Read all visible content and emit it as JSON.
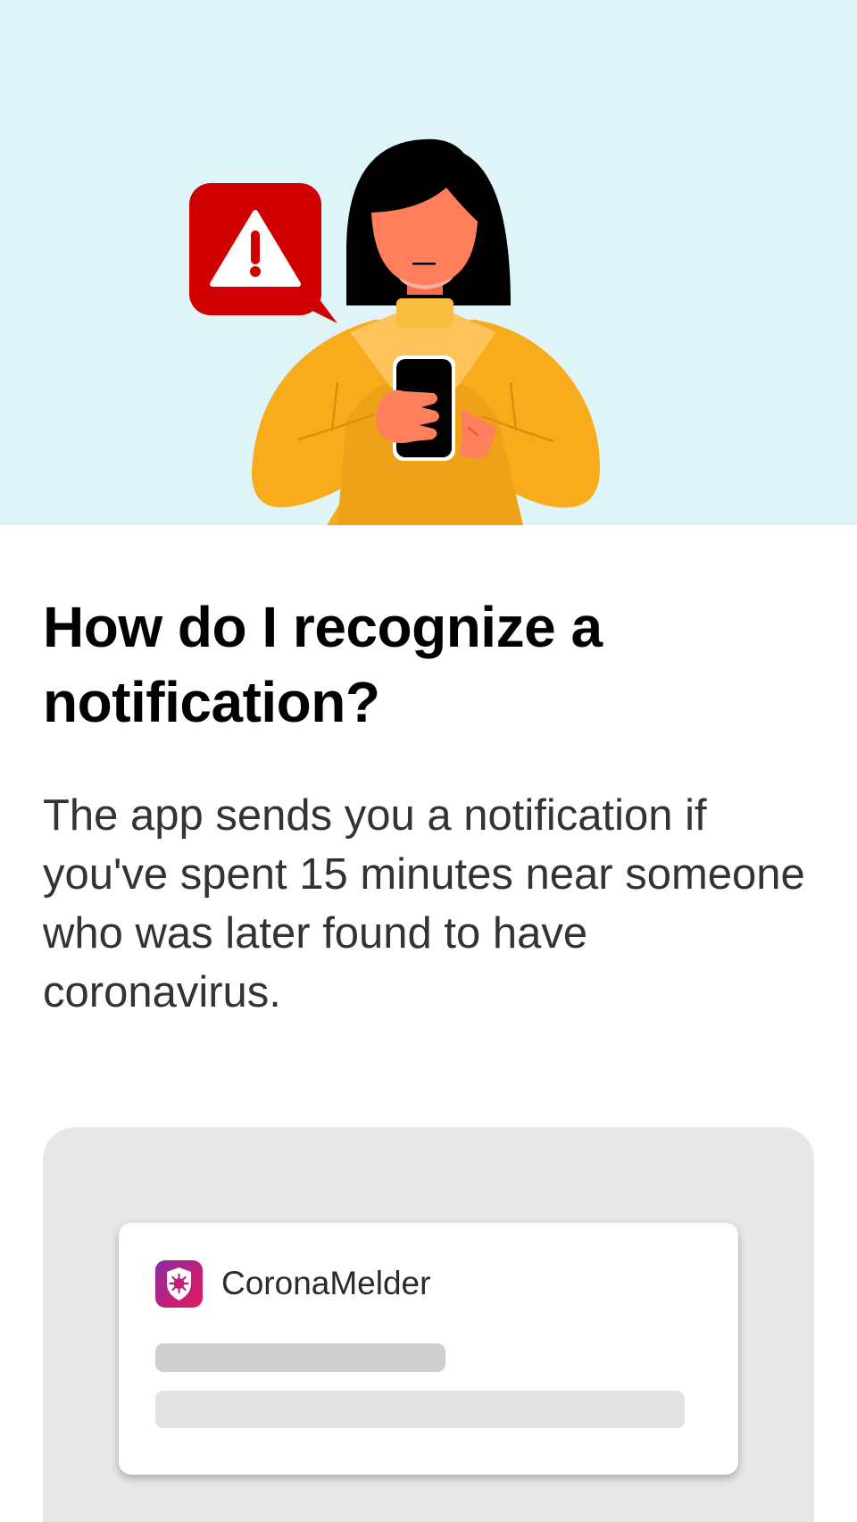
{
  "onboarding": {
    "title": "How do I recognize a notification?",
    "body": "The app sends you a notification if you've spent 15 minutes near someone who was later found to have coronavirus."
  },
  "illustration": {
    "alert_icon": "warning-triangle-icon",
    "figure": "person-holding-phone"
  },
  "notification_preview": {
    "app_name": "CoronaMelder",
    "app_icon": "coronamelder-shield-icon"
  },
  "colors": {
    "hero_background": "#dff4f7",
    "alert_red": "#d10000",
    "sweater_yellow": "#f9ac1b",
    "skin": "#ff7f5c",
    "app_icon_magenta": "#c0207a",
    "panel_gray": "#e8e8e8"
  }
}
